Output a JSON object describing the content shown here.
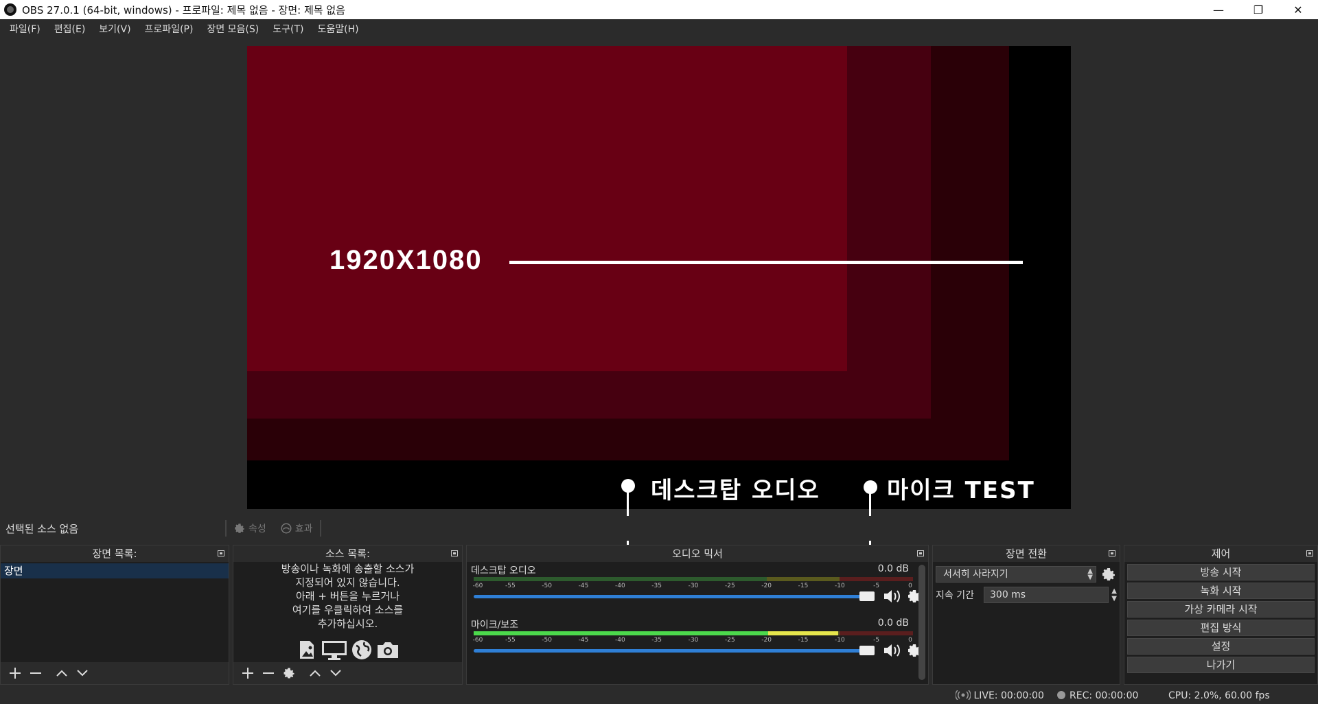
{
  "window": {
    "title": "OBS 27.0.1 (64-bit, windows) - 프로파일: 제목 없음 - 장면: 제목 없음",
    "minimize": "—",
    "maximize": "❐",
    "close": "✕"
  },
  "menu": [
    "파일(F)",
    "편집(E)",
    "보기(V)",
    "프로파일(P)",
    "장면 모음(S)",
    "도구(T)",
    "도움말(H)"
  ],
  "preview": {
    "resolution_label": "1920X1080",
    "callout_desktop": "데스크탑 오디오",
    "callout_mic": "마이크 TEST",
    "colors": {
      "outer": "#000000",
      "layer1": "#2a0007",
      "layer2": "#460010",
      "layer3": "#680014"
    }
  },
  "selection_bar": {
    "text": "선택된 소스 없음",
    "properties": "속성",
    "filters": "효과"
  },
  "scenes": {
    "title": "장면 목록:",
    "items": [
      "장면"
    ]
  },
  "sources": {
    "title": "소스 목록:",
    "help_lines": [
      "방송이나 녹화에 송출할 소스가",
      "지정되어 있지 않습니다.",
      "아래 + 버튼을 누르거나",
      "여기를 우클릭하여 소스를",
      "추가하십시오."
    ]
  },
  "mixer": {
    "title": "오디오 믹서",
    "scale": [
      "-60",
      "-55",
      "-50",
      "-45",
      "-40",
      "-35",
      "-30",
      "-25",
      "-20",
      "-15",
      "-10",
      "-5",
      "0"
    ],
    "channels": [
      {
        "name": "데스크탑 오디오",
        "db": "0.0 dB",
        "level_green": 0.0,
        "level_yellow": 0.0
      },
      {
        "name": "마이크/보조",
        "db": "0.0 dB",
        "level_green": 0.67,
        "level_yellow": 0.83
      }
    ],
    "accent": "#2f7fd6"
  },
  "transitions": {
    "title": "장면 전환",
    "selected": "서서히 사라지기",
    "duration_label": "지속 기간",
    "duration_value": "300 ms"
  },
  "controls": {
    "title": "제어",
    "buttons": [
      "방송 시작",
      "녹화 시작",
      "가상 카메라 시작",
      "편집 방식",
      "설정",
      "나가기"
    ]
  },
  "status": {
    "live": "LIVE: 00:00:00",
    "rec": "REC: 00:00:00",
    "cpu": "CPU: 2.0%, 60.00 fps"
  }
}
